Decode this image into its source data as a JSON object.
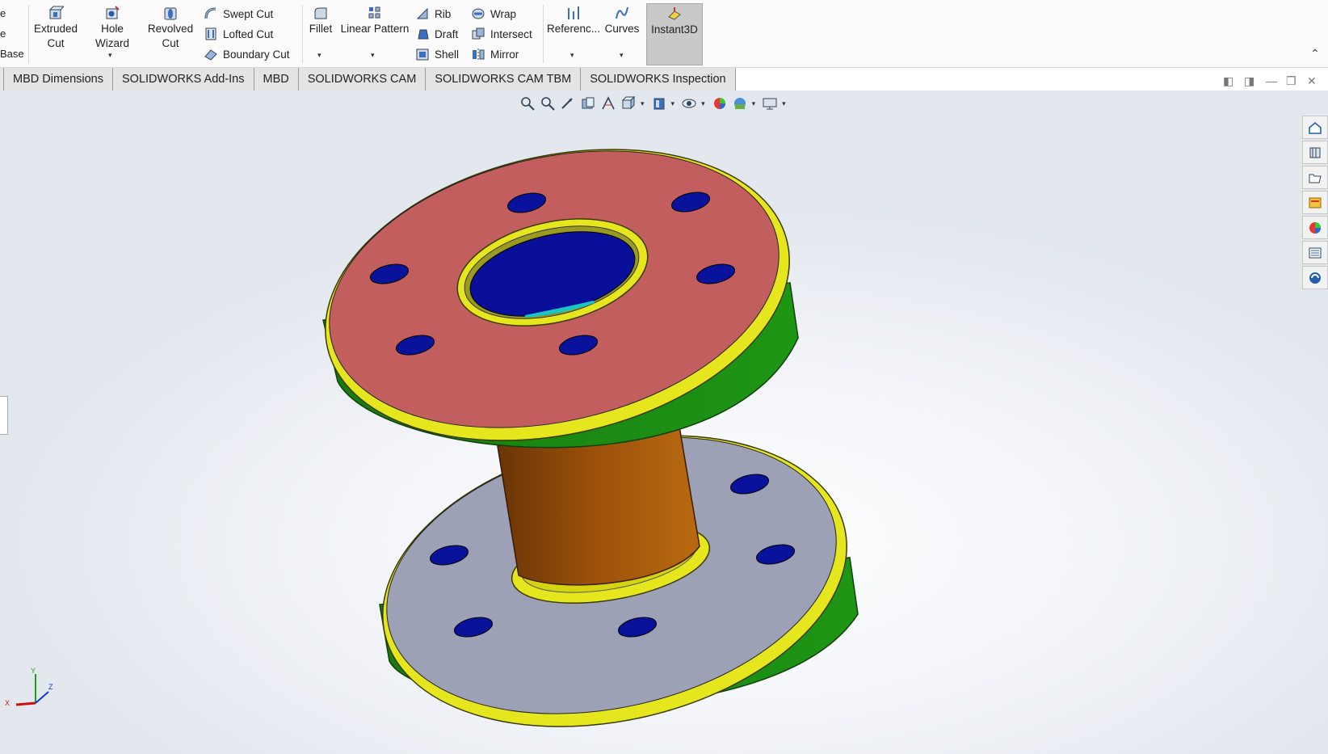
{
  "ribbon": {
    "clipped_left_labels": [
      "e",
      "e",
      "Base"
    ],
    "buttons": {
      "extruded_cut": "Extruded\nCut",
      "hole_wizard": "Hole Wizard",
      "revolved_cut": "Revolved\nCut",
      "swept_cut": "Swept Cut",
      "lofted_cut": "Lofted Cut",
      "boundary_cut": "Boundary Cut",
      "fillet": "Fillet",
      "linear_pattern": "Linear Pattern",
      "rib": "Rib",
      "draft": "Draft",
      "shell": "Shell",
      "wrap": "Wrap",
      "intersect": "Intersect",
      "mirror": "Mirror",
      "reference": "Referenc...",
      "curves": "Curves",
      "instant3d": "Instant3D"
    },
    "caret": "▾",
    "collapse": "⌃"
  },
  "tabs": [
    "MBD Dimensions",
    "SOLIDWORKS Add-Ins",
    "MBD",
    "SOLIDWORKS CAM",
    "SOLIDWORKS CAM TBM",
    "SOLIDWORKS Inspection"
  ],
  "window_controls": [
    "◧",
    "◨",
    "—",
    "❐",
    "✕"
  ],
  "triad": {
    "x": "X",
    "y": "Y",
    "z": "Z"
  },
  "colors": {
    "top_face": "#c25e5e",
    "bottom_face": "#9da1b5",
    "flange_side": "#1c8a14",
    "ring": "#e6e61e",
    "holes": "#08129a",
    "hub": "#a85a0c",
    "bore": "#0a0f99"
  }
}
